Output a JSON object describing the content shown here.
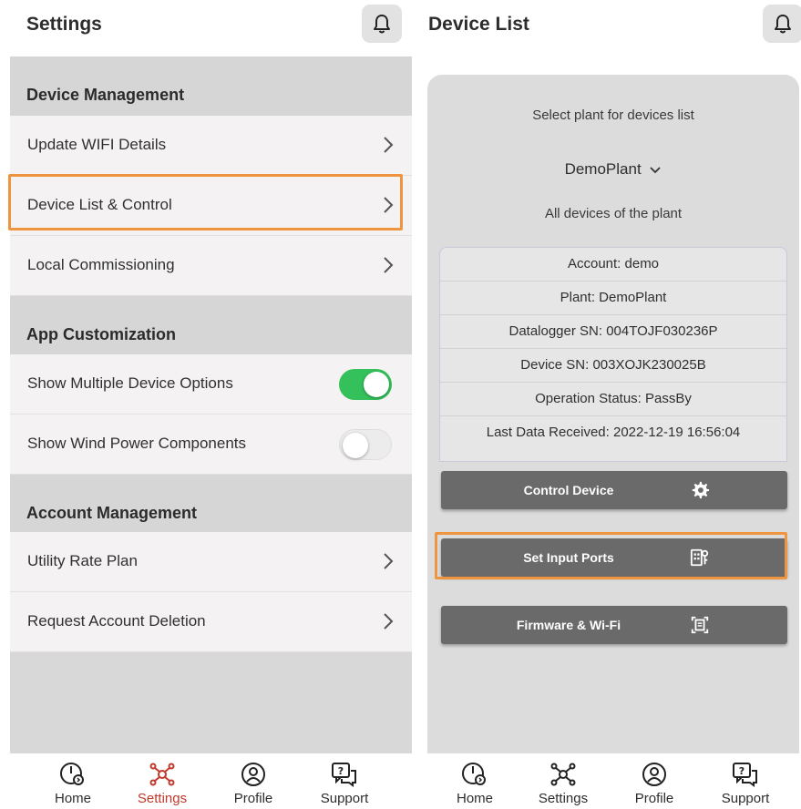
{
  "left_panel": {
    "title": "Settings",
    "bell_icon": "bell-icon",
    "sections": {
      "device_management": {
        "header": "Device Management",
        "items": [
          "Update WIFI Details",
          "Device List & Control",
          "Local Commissioning"
        ]
      },
      "app_customization": {
        "header": "App Customization",
        "toggles": [
          {
            "label": "Show Multiple Device Options",
            "state": "on"
          },
          {
            "label": "Show Wind Power Components",
            "state": "off"
          }
        ]
      },
      "account_management": {
        "header": "Account Management",
        "items": [
          "Utility Rate Plan",
          "Request Account Deletion"
        ]
      }
    },
    "nav": [
      {
        "label": "Home",
        "icon": "home-gauge-icon"
      },
      {
        "label": "Settings",
        "icon": "settings-network-icon",
        "active": true
      },
      {
        "label": "Profile",
        "icon": "profile-icon"
      },
      {
        "label": "Support",
        "icon": "support-chat-icon"
      }
    ]
  },
  "right_panel": {
    "title": "Device List",
    "bell_icon": "bell-icon",
    "select_label": "Select plant for devices list",
    "selected_plant": "DemoPlant",
    "all_devices_label": "All devices of the plant",
    "info": [
      "Account: demo",
      "Plant: DemoPlant",
      "Datalogger SN: 004TOJF030236P",
      "Device SN: 003XOJK230025B",
      "Operation Status: PassBy",
      "Last Data Received: 2022-12-19 16:56:04"
    ],
    "buttons": [
      {
        "label": "Control Device",
        "icon": "gear-icon"
      },
      {
        "label": "Set Input Ports",
        "icon": "ports-icon"
      },
      {
        "label": "Firmware & Wi-Fi",
        "icon": "firmware-scan-icon"
      }
    ],
    "nav": [
      {
        "label": "Home",
        "icon": "home-gauge-icon"
      },
      {
        "label": "Settings",
        "icon": "settings-network-icon"
      },
      {
        "label": "Profile",
        "icon": "profile-icon"
      },
      {
        "label": "Support",
        "icon": "support-chat-icon"
      }
    ]
  },
  "colors": {
    "highlight": "#f0953f",
    "toggle_on": "#34c05a",
    "active_nav": "#c0392b",
    "button_bg": "#6a6a6a"
  }
}
